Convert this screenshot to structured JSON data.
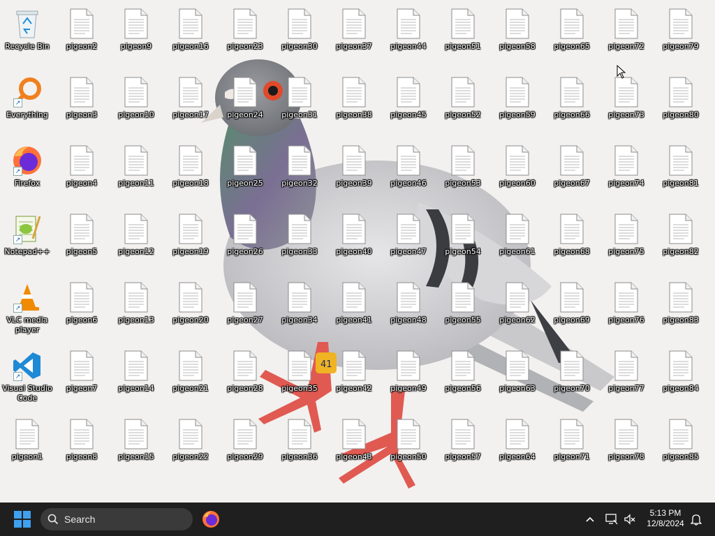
{
  "desktop": {
    "special_icons": [
      {
        "name": "recycle-bin",
        "label": "Recycle Bin",
        "icon": "recycle-bin-icon",
        "shortcut": false
      },
      {
        "name": "everything",
        "label": "Everything",
        "icon": "magnifier-icon",
        "shortcut": true
      },
      {
        "name": "firefox",
        "label": "Firefox",
        "icon": "firefox-icon",
        "shortcut": true
      },
      {
        "name": "notepadpp",
        "label": "Notepad++",
        "icon": "notepad-plus-plus-icon",
        "shortcut": true
      },
      {
        "name": "vlc",
        "label": "VLC media player",
        "icon": "vlc-cone-icon",
        "shortcut": true
      },
      {
        "name": "vscode",
        "label": "Visual Studio Code",
        "icon": "vscode-icon",
        "shortcut": true
      },
      {
        "name": "pigeon1",
        "label": "pigeon1",
        "icon": "file-icon",
        "shortcut": false
      }
    ],
    "file_columns": [
      [
        "pigeon2",
        "pigeon3",
        "pigeon4",
        "pigeon5",
        "pigeon6",
        "pigeon7",
        "pigeon8"
      ],
      [
        "pigeon9",
        "pigeon10",
        "pigeon11",
        "pigeon12",
        "pigeon13",
        "pigeon14",
        "pigeon15"
      ],
      [
        "pigeon16",
        "pigeon17",
        "pigeon18",
        "pigeon19",
        "pigeon20",
        "pigeon21",
        "pigeon22"
      ],
      [
        "pigeon23",
        "pigeon24",
        "pigeon25",
        "pigeon26",
        "pigeon27",
        "pigeon28",
        "pigeon29"
      ],
      [
        "pigeon30",
        "pigeon31",
        "pigeon32",
        "pigeon33",
        "pigeon34",
        "pigeon35",
        "pigeon36"
      ],
      [
        "pigeon37",
        "pigeon38",
        "pigeon39",
        "pigeon40",
        "pigeon41",
        "pigeon42",
        "pigeon43"
      ],
      [
        "pigeon44",
        "pigeon45",
        "pigeon46",
        "pigeon47",
        "pigeon48",
        "pigeon49",
        "pigeon50"
      ],
      [
        "pigeon51",
        "pigeon52",
        "pigeon53",
        "pigeon54",
        "pigeon55",
        "pigeon56",
        "pigeon57"
      ],
      [
        "pigeon58",
        "pigeon59",
        "pigeon60",
        "pigeon61",
        "pigeon62",
        "pigeon63",
        "pigeon64"
      ],
      [
        "pigeon65",
        "pigeon66",
        "pigeon67",
        "pigeon68",
        "pigeon69",
        "pigeon70",
        "pigeon71"
      ],
      [
        "pigeon72",
        "pigeon73",
        "pigeon74",
        "pigeon75",
        "pigeon76",
        "pigeon77",
        "pigeon78"
      ],
      [
        "pigeon79",
        "pigeon80",
        "pigeon81",
        "pigeon82",
        "pigeon83",
        "pigeon84",
        "pigeon85"
      ]
    ],
    "wallpaper": {
      "subject": "pigeon-wallpaper",
      "band_text": "41"
    }
  },
  "taskbar": {
    "search_placeholder": "Search",
    "pinned": [
      "firefox-icon"
    ],
    "tray_icons": [
      "chevron-up-icon",
      "network-icon",
      "volume-muted-icon",
      "notification-bell-icon"
    ],
    "time": "5:13 PM",
    "date": "12/8/2024"
  },
  "colors": {
    "taskbar_bg": "#1f1f1f",
    "start_blue": "#3fa0f0",
    "desktop_bg": "#f2f1ef"
  }
}
